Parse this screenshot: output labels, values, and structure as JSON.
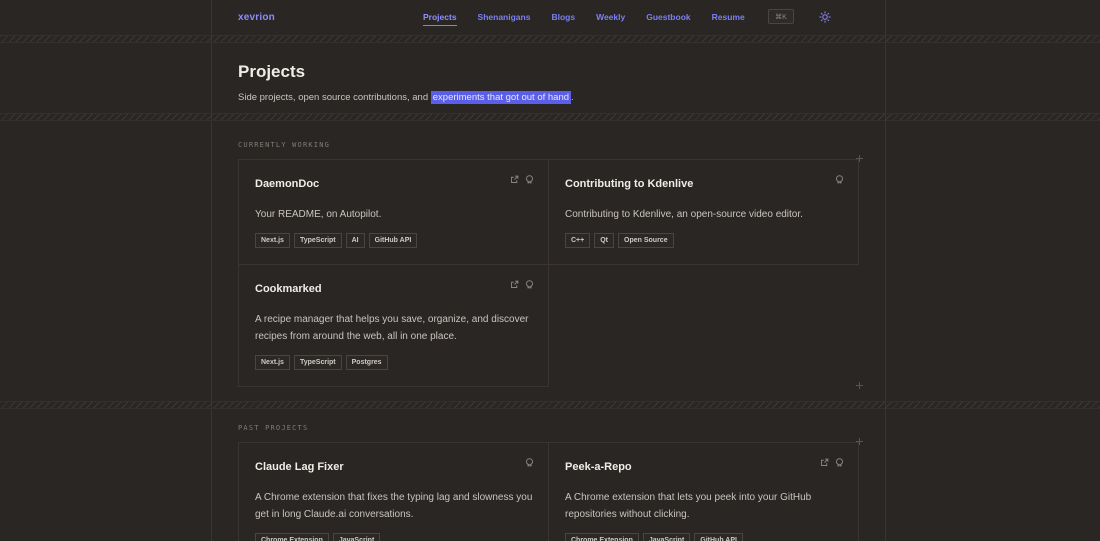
{
  "nav": {
    "brand": "xevrion",
    "links": [
      "Projects",
      "Shenanigans",
      "Blogs",
      "Weekly",
      "Guestbook",
      "Resume"
    ],
    "shortcut": "⌘K",
    "theme_icon": "sun-icon"
  },
  "hero": {
    "title": "Projects",
    "subtitle_prefix": "Side projects, open source contributions, and ",
    "subtitle_highlight": "experiments that got out of hand",
    "subtitle_suffix": "."
  },
  "sections": {
    "current_label": "CURRENTLY WORKING",
    "past_label": "PAST PROJECTS"
  },
  "current": [
    {
      "name": "DaemonDoc",
      "desc": "Your README, on Autopilot.",
      "tags": [
        "Next.js",
        "TypeScript",
        "AI",
        "GitHub API"
      ]
    },
    {
      "name": "Contributing to Kdenlive",
      "desc": "Contributing to Kdenlive, an open-source video editor.",
      "tags": [
        "C++",
        "Qt",
        "Open Source"
      ]
    },
    {
      "name": "Cookmarked",
      "desc": "A recipe manager that helps you save, organize, and discover recipes from around the web, all in one place.",
      "tags": [
        "Next.js",
        "TypeScript",
        "Postgres"
      ]
    }
  ],
  "past": [
    {
      "name": "Claude Lag Fixer",
      "desc": "A Chrome extension that fixes the typing lag and slowness you get in long Claude.ai conversations.",
      "tags": [
        "Chrome Extension",
        "JavaScript"
      ]
    },
    {
      "name": "Peek-a-Repo",
      "desc": "A Chrome extension that lets you peek into your GitHub repositories without clicking.",
      "tags": [
        "Chrome Extension",
        "JavaScript",
        "GitHub API"
      ]
    }
  ],
  "colors": {
    "accent": "#7b80f0",
    "background": "#2a2624",
    "highlight": "#5b5ee8"
  }
}
